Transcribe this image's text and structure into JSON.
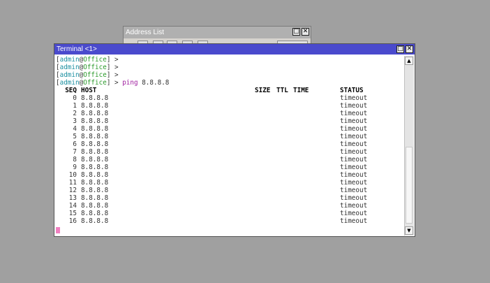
{
  "address_window": {
    "title": "Address List"
  },
  "terminal": {
    "title": "Terminal <1>",
    "prompt": {
      "user": "admin",
      "host": "Office"
    },
    "command": "ping",
    "command_arg": "8.8.8.8",
    "headers": {
      "seq": "SEQ",
      "host": "HOST",
      "size": "SIZE",
      "ttl": "TTL",
      "time": "TIME",
      "status": "STATUS"
    },
    "rows": [
      {
        "seq": "0",
        "host": "8.8.8.8",
        "status": "timeout"
      },
      {
        "seq": "1",
        "host": "8.8.8.8",
        "status": "timeout"
      },
      {
        "seq": "2",
        "host": "8.8.8.8",
        "status": "timeout"
      },
      {
        "seq": "3",
        "host": "8.8.8.8",
        "status": "timeout"
      },
      {
        "seq": "4",
        "host": "8.8.8.8",
        "status": "timeout"
      },
      {
        "seq": "5",
        "host": "8.8.8.8",
        "status": "timeout"
      },
      {
        "seq": "6",
        "host": "8.8.8.8",
        "status": "timeout"
      },
      {
        "seq": "7",
        "host": "8.8.8.8",
        "status": "timeout"
      },
      {
        "seq": "8",
        "host": "8.8.8.8",
        "status": "timeout"
      },
      {
        "seq": "9",
        "host": "8.8.8.8",
        "status": "timeout"
      },
      {
        "seq": "10",
        "host": "8.8.8.8",
        "status": "timeout"
      },
      {
        "seq": "11",
        "host": "8.8.8.8",
        "status": "timeout"
      },
      {
        "seq": "12",
        "host": "8.8.8.8",
        "status": "timeout"
      },
      {
        "seq": "13",
        "host": "8.8.8.8",
        "status": "timeout"
      },
      {
        "seq": "14",
        "host": "8.8.8.8",
        "status": "timeout"
      },
      {
        "seq": "15",
        "host": "8.8.8.8",
        "status": "timeout"
      },
      {
        "seq": "16",
        "host": "8.8.8.8",
        "status": "timeout"
      }
    ]
  },
  "colors": {
    "desktop": "#a0a0a0",
    "terminal_title_bar": "#4a4acd",
    "prompt_user": "#1a8fa0",
    "prompt_host": "#2a9a2a",
    "command": "#a020a0",
    "cursor": "#f080c0"
  },
  "icons": [
    "maximize-icon",
    "close-icon",
    "scroll-up-icon",
    "scroll-down-icon"
  ]
}
